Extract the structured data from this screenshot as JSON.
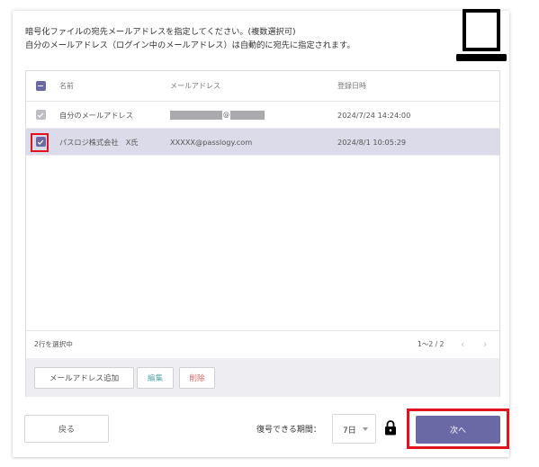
{
  "instructions": {
    "line1": "暗号化ファイルの宛先メールアドレスを指定してください。(複数選択可)",
    "line2": "自分のメールアドレス（ログイン中のメールアドレス）は自動的に宛先に指定されます。"
  },
  "table": {
    "columns": {
      "name": "名前",
      "email": "メールアドレス",
      "registered": "登録日時"
    },
    "rows": [
      {
        "name": "自分のメールアドレス",
        "email_at": "@",
        "registered": "2024/7/24 14:24:00",
        "checked": true,
        "disabled": true,
        "email_masked": true
      },
      {
        "name": "パスロジ株式会社　X氏",
        "email": "XXXXX@passlogy.com",
        "registered": "2024/8/1 10:05:29",
        "checked": true,
        "disabled": false,
        "email_masked": false
      }
    ],
    "selected_count": "2行を選択中",
    "pagination": "1〜2 / 2",
    "prev_icon": "‹",
    "next_icon": "›"
  },
  "actions": {
    "add_email": "メールアドレス追加",
    "edit": "編集",
    "delete": "削除"
  },
  "footer": {
    "back": "戻る",
    "period_label": "復号できる期間：",
    "period_value": "7日",
    "next": "次へ"
  },
  "colors": {
    "accent": "#6a69a6",
    "selected_row": "#dcdbe9",
    "highlight": "#e1131e",
    "edit_text": "#5aa6a6",
    "delete_text": "#d66b6b"
  },
  "icons": {
    "laptop": "laptop-icon",
    "lock": "lock-icon",
    "checkbox_checked": "checkmark-icon"
  }
}
